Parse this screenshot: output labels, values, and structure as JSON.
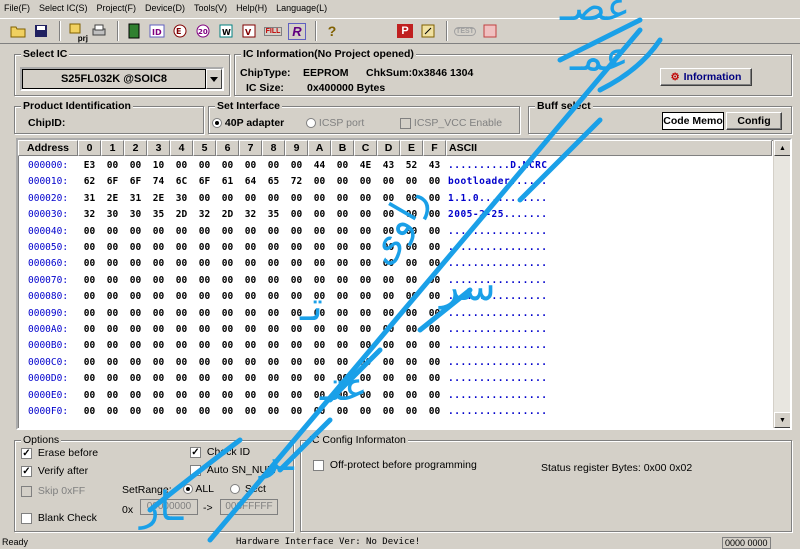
{
  "menu": [
    "File(F)",
    "Select IC(S)",
    "Project(F)",
    "Device(D)",
    "Tools(V)",
    "Help(H)",
    "Language(L)"
  ],
  "toolbar": {
    "prj_label": "prj",
    "fill_label": "FILL",
    "r_label": "R",
    "p_label": "P",
    "test_label": "TEST"
  },
  "select_ic": {
    "title": "Select IC",
    "value": "S25FL032K @SOIC8"
  },
  "ic_info": {
    "title": "IC Information(No Project opened)",
    "chiptype_label": "ChipType:",
    "chiptype_value": "EEPROM",
    "chksum_label": "ChkSum:",
    "chksum_value": "0x3846 1304",
    "size_label": "IC Size:",
    "size_value": "0x400000 Bytes",
    "info_button": "Information"
  },
  "product_id": {
    "title": "Product Identification",
    "chipid_label": "ChipID:"
  },
  "set_interface": {
    "title": "Set Interface",
    "opt1": "40P adapter",
    "opt2": "ICSP port",
    "opt3": "ICSP_VCC Enable"
  },
  "buff_select": {
    "title": "Buff select",
    "code_memo": "Code Memo",
    "config": "Config"
  },
  "hex": {
    "columns": [
      "Address",
      "0",
      "1",
      "2",
      "3",
      "4",
      "5",
      "6",
      "7",
      "8",
      "9",
      "A",
      "B",
      "C",
      "D",
      "E",
      "F",
      "ASCII"
    ],
    "rows": [
      {
        "addr": "000000:",
        "cells": [
          "E3",
          "00",
          "00",
          "10",
          "00",
          "00",
          "00",
          "00",
          "00",
          "00",
          "44",
          "00",
          "4E",
          "43",
          "52",
          "43"
        ],
        "ascii": "..........D.NCRC"
      },
      {
        "addr": "000010:",
        "cells": [
          "62",
          "6F",
          "6F",
          "74",
          "6C",
          "6F",
          "61",
          "64",
          "65",
          "72",
          "00",
          "00",
          "00",
          "00",
          "00",
          "00"
        ],
        "ascii": "bootloader......"
      },
      {
        "addr": "000020:",
        "cells": [
          "31",
          "2E",
          "31",
          "2E",
          "30",
          "00",
          "00",
          "00",
          "00",
          "00",
          "00",
          "00",
          "00",
          "00",
          "00",
          "00"
        ],
        "ascii": "1.1.0..........."
      },
      {
        "addr": "000030:",
        "cells": [
          "32",
          "30",
          "30",
          "35",
          "2D",
          "32",
          "2D",
          "32",
          "35",
          "00",
          "00",
          "00",
          "00",
          "00",
          "00",
          "00"
        ],
        "ascii": "2005-2-25......."
      },
      {
        "addr": "000040:",
        "cells": [
          "00",
          "00",
          "00",
          "00",
          "00",
          "00",
          "00",
          "00",
          "00",
          "00",
          "00",
          "00",
          "00",
          "00",
          "00",
          "00"
        ],
        "ascii": "................"
      },
      {
        "addr": "000050:",
        "cells": [
          "00",
          "00",
          "00",
          "00",
          "00",
          "00",
          "00",
          "00",
          "00",
          "00",
          "00",
          "00",
          "00",
          "00",
          "00",
          "00"
        ],
        "ascii": "................"
      },
      {
        "addr": "000060:",
        "cells": [
          "00",
          "00",
          "00",
          "00",
          "00",
          "00",
          "00",
          "00",
          "00",
          "00",
          "00",
          "00",
          "00",
          "00",
          "00",
          "00"
        ],
        "ascii": "................"
      },
      {
        "addr": "000070:",
        "cells": [
          "00",
          "00",
          "00",
          "00",
          "00",
          "00",
          "00",
          "00",
          "00",
          "00",
          "00",
          "00",
          "00",
          "00",
          "00",
          "00"
        ],
        "ascii": "................"
      },
      {
        "addr": "000080:",
        "cells": [
          "00",
          "00",
          "00",
          "00",
          "00",
          "00",
          "00",
          "00",
          "00",
          "00",
          "00",
          "00",
          "00",
          "00",
          "00",
          "00"
        ],
        "ascii": "................"
      },
      {
        "addr": "000090:",
        "cells": [
          "00",
          "00",
          "00",
          "00",
          "00",
          "00",
          "00",
          "00",
          "00",
          "00",
          "00",
          "00",
          "00",
          "00",
          "00",
          "00"
        ],
        "ascii": "................"
      },
      {
        "addr": "0000A0:",
        "cells": [
          "00",
          "00",
          "00",
          "00",
          "00",
          "00",
          "00",
          "00",
          "00",
          "00",
          "00",
          "00",
          "00",
          "00",
          "00",
          "00"
        ],
        "ascii": "................"
      },
      {
        "addr": "0000B0:",
        "cells": [
          "00",
          "00",
          "00",
          "00",
          "00",
          "00",
          "00",
          "00",
          "00",
          "00",
          "00",
          "00",
          "00",
          "00",
          "00",
          "00"
        ],
        "ascii": "................"
      },
      {
        "addr": "0000C0:",
        "cells": [
          "00",
          "00",
          "00",
          "00",
          "00",
          "00",
          "00",
          "00",
          "00",
          "00",
          "00",
          "00",
          "00",
          "00",
          "00",
          "00"
        ],
        "ascii": "................"
      },
      {
        "addr": "0000D0:",
        "cells": [
          "00",
          "00",
          "00",
          "00",
          "00",
          "00",
          "00",
          "00",
          "00",
          "00",
          "00",
          "00",
          "00",
          "00",
          "00",
          "00"
        ],
        "ascii": "................"
      },
      {
        "addr": "0000E0:",
        "cells": [
          "00",
          "00",
          "00",
          "00",
          "00",
          "00",
          "00",
          "00",
          "00",
          "00",
          "00",
          "00",
          "00",
          "00",
          "00",
          "00"
        ],
        "ascii": "................"
      },
      {
        "addr": "0000F0:",
        "cells": [
          "00",
          "00",
          "00",
          "00",
          "00",
          "00",
          "00",
          "00",
          "00",
          "00",
          "00",
          "00",
          "00",
          "00",
          "00",
          "00"
        ],
        "ascii": "................"
      }
    ]
  },
  "options": {
    "title": "Options",
    "erase_before": "Erase before",
    "verify_after": "Verify after",
    "skip_0xff": "Skip 0xFF",
    "blank_check": "Blank Check",
    "check_id": "Check ID",
    "auto_sn": "Auto SN_NUM",
    "setrange_label": "SetRange:",
    "all_label": "ALL",
    "sect_label": "Sect",
    "ox_label": "0x",
    "arrow": "->",
    "range_start": "00000000",
    "range_end": "003FFFFF"
  },
  "ic_config": {
    "title": "IC Config Informaton",
    "off_protect": "Off-protect before programming",
    "status_reg": "Status register Bytes: 0x00 0x02"
  },
  "status": {
    "ready": "Ready",
    "hw_info": "Hardware Interface Ver: No Device!",
    "counter": "0000 0000"
  },
  "overlay_text": [
    "عصـ",
    "عمـ",
    "راوی",
    "تـ",
    "سر",
    "عتـ",
    "ـار",
    "ـر"
  ]
}
